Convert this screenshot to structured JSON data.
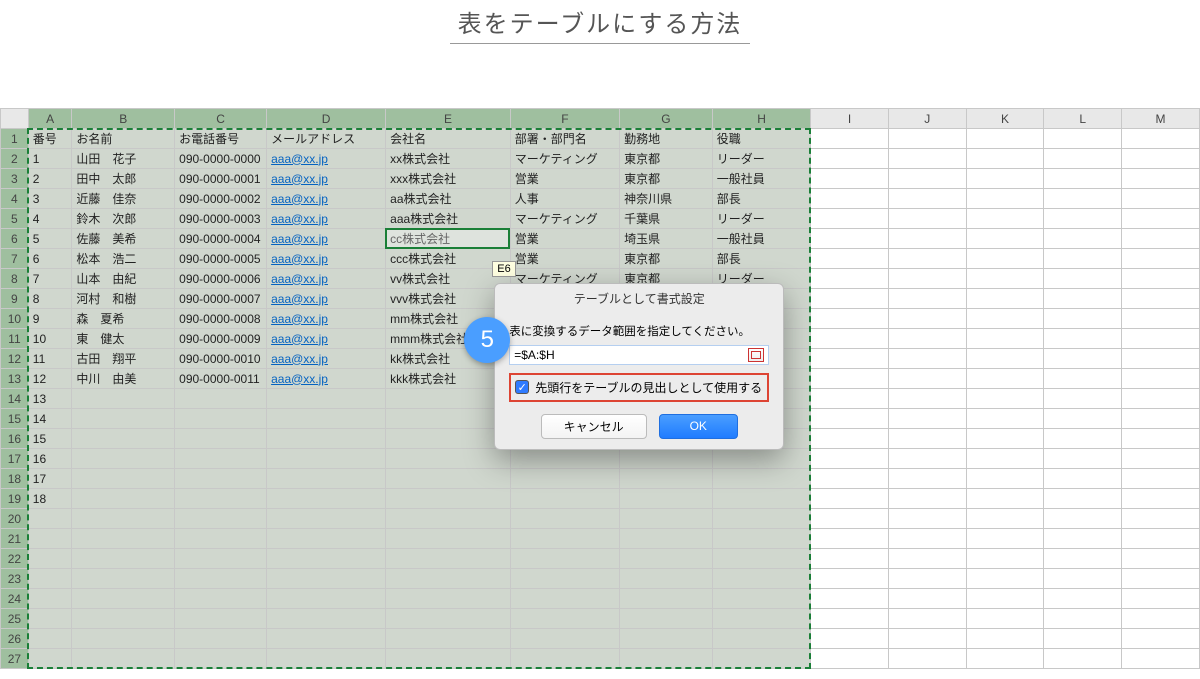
{
  "page": {
    "title": "表をテーブルにする方法"
  },
  "step_badge": "5",
  "tooltip": "E6",
  "columns_letters": [
    "A",
    "B",
    "C",
    "D",
    "E",
    "F",
    "G",
    "H",
    "I",
    "J",
    "K",
    "L",
    "M"
  ],
  "headers": [
    "番号",
    "お名前",
    "お電話番号",
    "メールアドレス",
    "会社名",
    "部署・部門名",
    "勤務地",
    "役職"
  ],
  "rows": [
    {
      "no": "1",
      "name": "山田　花子",
      "tel": "090-0000-0000",
      "mail": "aaa@xx.jp",
      "co": "xx株式会社",
      "dept": "マーケティング",
      "loc": "東京都",
      "role": "リーダー"
    },
    {
      "no": "2",
      "name": "田中　太郎",
      "tel": "090-0000-0001",
      "mail": "aaa@xx.jp",
      "co": "xxx株式会社",
      "dept": "営業",
      "loc": "東京都",
      "role": "一般社員"
    },
    {
      "no": "3",
      "name": "近藤　佳奈",
      "tel": "090-0000-0002",
      "mail": "aaa@xx.jp",
      "co": "aa株式会社",
      "dept": "人事",
      "loc": "神奈川県",
      "role": "部長"
    },
    {
      "no": "4",
      "name": "鈴木　次郎",
      "tel": "090-0000-0003",
      "mail": "aaa@xx.jp",
      "co": "aaa株式会社",
      "dept": "マーケティング",
      "loc": "千葉県",
      "role": "リーダー"
    },
    {
      "no": "5",
      "name": "佐藤　美希",
      "tel": "090-0000-0004",
      "mail": "aaa@xx.jp",
      "co": "cc株式会社",
      "dept": "営業",
      "loc": "埼玉県",
      "role": "一般社員"
    },
    {
      "no": "6",
      "name": "松本　浩二",
      "tel": "090-0000-0005",
      "mail": "aaa@xx.jp",
      "co": "ccc株式会社",
      "dept": "営業",
      "loc": "東京都",
      "role": "部長"
    },
    {
      "no": "7",
      "name": "山本　由紀",
      "tel": "090-0000-0006",
      "mail": "aaa@xx.jp",
      "co": "vv株式会社",
      "dept": "マーケティング",
      "loc": "東京都",
      "role": "リーダー"
    },
    {
      "no": "8",
      "name": "河村　和樹",
      "tel": "090-0000-0007",
      "mail": "aaa@xx.jp",
      "co": "vvv株式会社",
      "dept": "",
      "loc": "",
      "role": ""
    },
    {
      "no": "9",
      "name": "森　夏希",
      "tel": "090-0000-0008",
      "mail": "aaa@xx.jp",
      "co": "mm株式会社",
      "dept": "",
      "loc": "",
      "role": ""
    },
    {
      "no": "10",
      "name": "東　健太",
      "tel": "090-0000-0009",
      "mail": "aaa@xx.jp",
      "co": "mmm株式会社",
      "dept": "",
      "loc": "",
      "role": ""
    },
    {
      "no": "11",
      "name": "古田　翔平",
      "tel": "090-0000-0010",
      "mail": "aaa@xx.jp",
      "co": "kk株式会社",
      "dept": "",
      "loc": "",
      "role": ""
    },
    {
      "no": "12",
      "name": "中川　由美",
      "tel": "090-0000-0011",
      "mail": "aaa@xx.jp",
      "co": "kkk株式会社",
      "dept": "",
      "loc": "",
      "role": ""
    }
  ],
  "extra_numbers": [
    "13",
    "14",
    "15",
    "16",
    "17",
    "18"
  ],
  "total_visible_rows": 27,
  "dialog": {
    "title": "テーブルとして書式設定",
    "message": "表に変換するデータ範囲を指定してください。",
    "range_value": "=$A:$H",
    "checkbox_label": "先頭行をテーブルの見出しとして使用する",
    "checkbox_checked": true,
    "cancel": "キャンセル",
    "ok": "OK"
  }
}
